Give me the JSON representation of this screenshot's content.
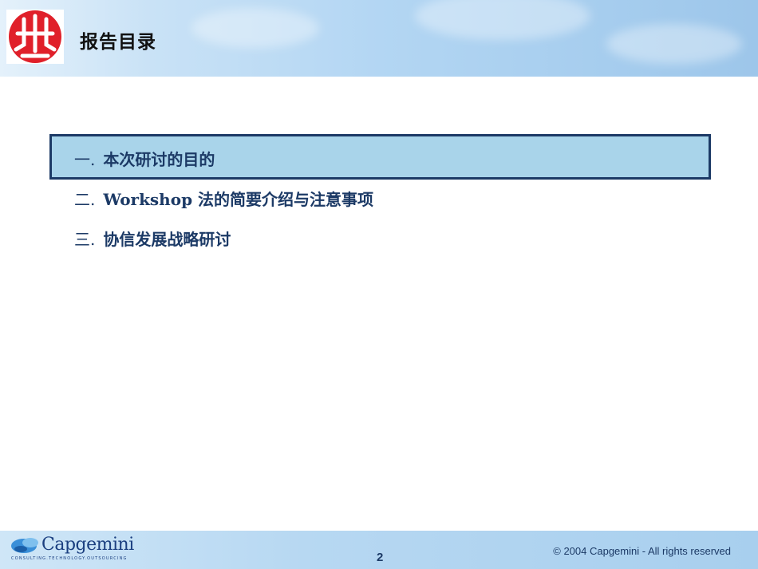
{
  "header": {
    "title": "报告目录",
    "logo_icon": "red-circle-emblem-icon"
  },
  "toc": {
    "items": [
      {
        "num": "一.",
        "text": "本次研讨的目的",
        "active": true
      },
      {
        "num": "二.",
        "text": "Workshop 法的简要介绍与注意事项",
        "active": false
      },
      {
        "num": "三.",
        "text": "协信发展战略研讨",
        "active": false
      }
    ]
  },
  "footer": {
    "brand": "Capgemini",
    "tagline": "CONSULTING.TECHNOLOGY.OUTSOURCING",
    "page_number": "2",
    "copyright": "© 2004 Capgemini - All rights reserved"
  },
  "colors": {
    "text": "#1c3a66",
    "highlight": "#a9d4ea",
    "logo_red": "#e0202a",
    "header_blue": "#a6cdee"
  }
}
